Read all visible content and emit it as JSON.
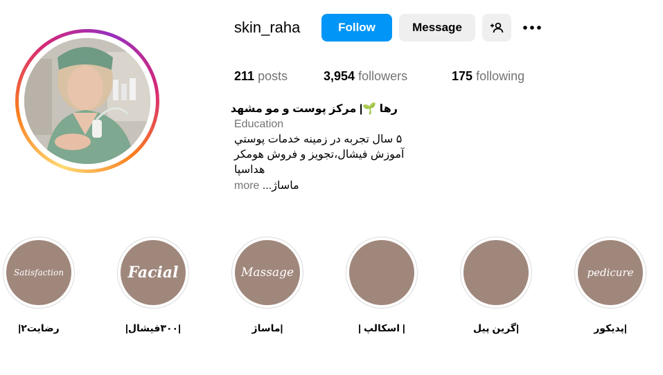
{
  "profile": {
    "username": "skin_raha",
    "follow_label": "Follow",
    "message_label": "Message",
    "add_user_icon": "person-plus-icon",
    "more_icon": "more-options-icon",
    "accent_color": "#0095f6"
  },
  "stats": {
    "posts_count": "211",
    "posts_label": "posts",
    "followers_count": "3,954",
    "followers_label": "followers",
    "following_count": "175",
    "following_label": "following"
  },
  "bio": {
    "name": "رها 🌱| مرکز پوست و مو مشهد",
    "category": "Education",
    "lines": [
      "۵ سال تجربه در زمینه خدمات پوستي",
      "آموزش فیشال،تجویز و فروش هومکر",
      "هداسپا",
      "ماساژ..."
    ],
    "more_label": "more"
  },
  "highlights": [
    {
      "cover_text": "Satisfaction",
      "label": "رضایت۲|"
    },
    {
      "cover_text": "Facial",
      "label": "|۳۰۰فیشال|"
    },
    {
      "cover_text": "Massage",
      "label": "|ماساژ"
    },
    {
      "cover_text": "",
      "label": "| اسکالپ |"
    },
    {
      "cover_text": "",
      "label": "|گرین پیل"
    },
    {
      "cover_text": "pedicure",
      "label": "|پدیکور"
    }
  ]
}
